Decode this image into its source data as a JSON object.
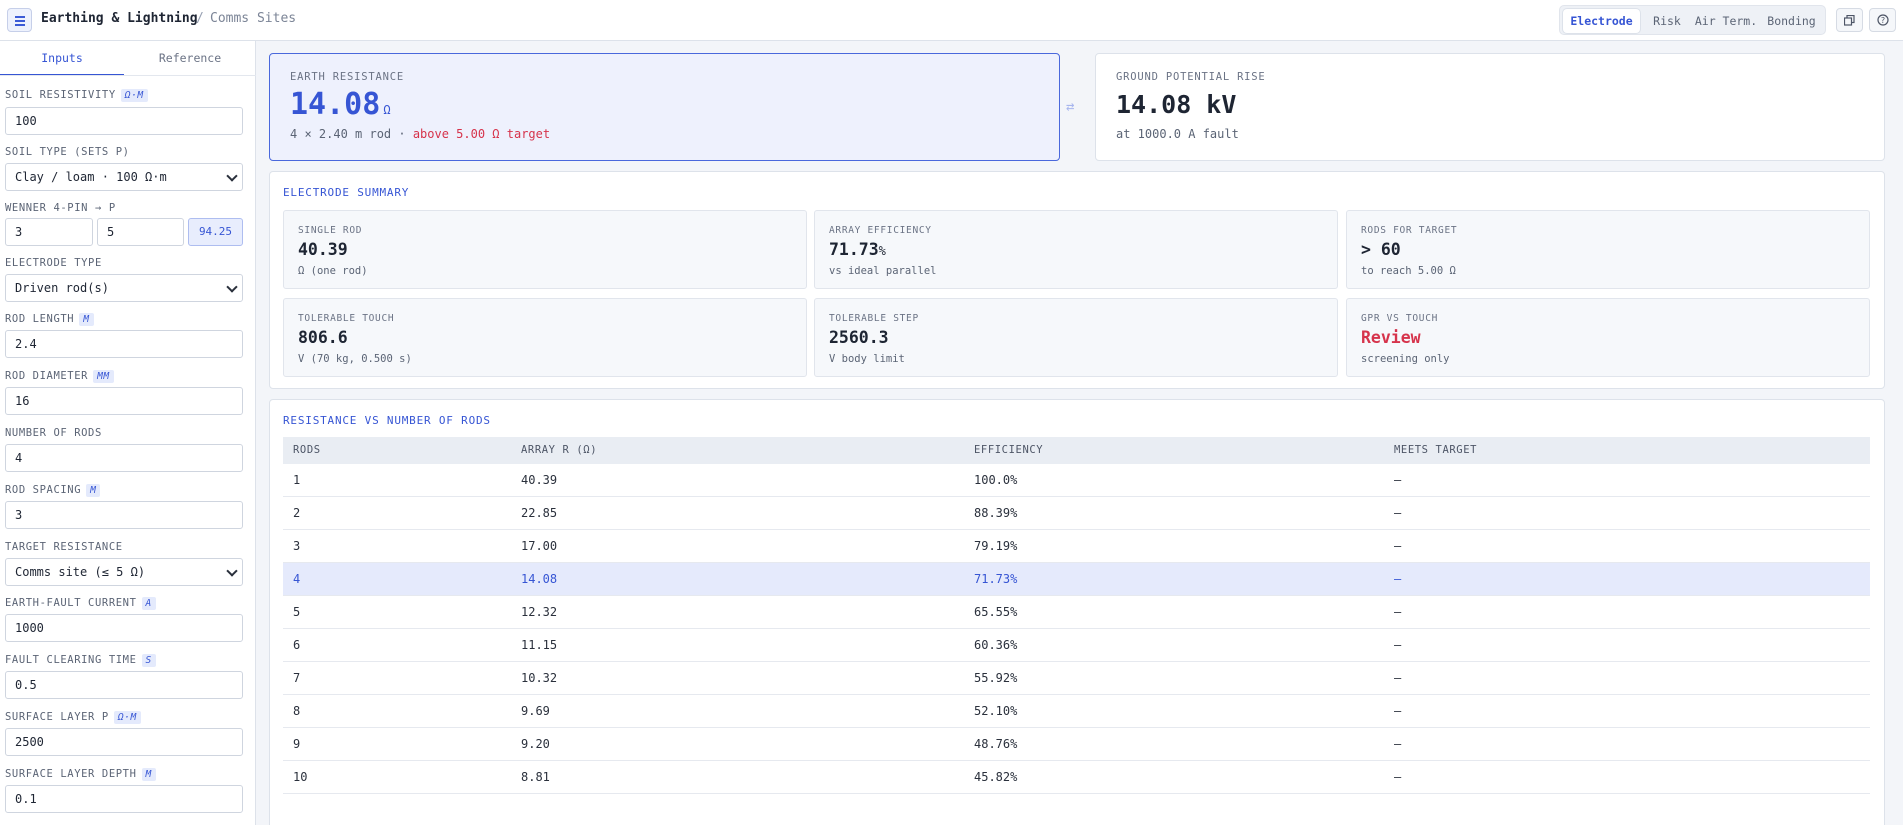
{
  "header": {
    "app_title": "Earthing & Lightning",
    "separator": "/",
    "subtitle": "Comms Sites",
    "tabs": [
      "Electrode",
      "Risk",
      "Air Term.",
      "Bonding"
    ],
    "active_tab": "Electrode"
  },
  "sidebar": {
    "tabs": [
      "Inputs",
      "Reference"
    ],
    "active_tab": "Inputs",
    "fields": {
      "soil_resistivity": {
        "label": "Soil resistivity",
        "unit": "Ω·m",
        "value": "100"
      },
      "soil_type": {
        "label": "Soil type (sets ρ)",
        "value": "Clay / loam · 100 Ω·m"
      },
      "wenner": {
        "label": "Wenner 4-pin → ρ",
        "value_a": "3",
        "value_b": "5",
        "result": "94.25"
      },
      "electrode_type": {
        "label": "Electrode type",
        "value": "Driven rod(s)"
      },
      "rod_length": {
        "label": "Rod length",
        "unit": "m",
        "value": "2.4"
      },
      "rod_diameter": {
        "label": "Rod diameter",
        "unit": "mm",
        "value": "16"
      },
      "number_of_rods": {
        "label": "Number of rods",
        "value": "4"
      },
      "rod_spacing": {
        "label": "Rod spacing",
        "unit": "m",
        "value": "3"
      },
      "target_resistance": {
        "label": "Target resistance",
        "value": "Comms site (≤ 5 Ω)"
      },
      "earth_fault_current": {
        "label": "Earth-fault current",
        "unit": "A",
        "value": "1000"
      },
      "fault_clearing_time": {
        "label": "Fault clearing time",
        "unit": "s",
        "value": "0.5"
      },
      "surface_layer_rho": {
        "label": "Surface layer ρ",
        "unit": "Ω·m",
        "value": "2500"
      },
      "surface_layer_depth": {
        "label": "Surface layer depth",
        "unit": "m",
        "value": "0.1"
      }
    }
  },
  "kpi": {
    "earth_resistance": {
      "label": "Earth resistance",
      "value": "14.08",
      "unit": "Ω",
      "sub_prefix": "4 × 2.40 m rod · ",
      "sub_warning": "above 5.00 Ω target"
    },
    "swap_icon": "⇄",
    "gpr": {
      "label": "Ground potential rise",
      "value": "14.08 kV",
      "sub": "at 1000.0 A fault"
    }
  },
  "summary": {
    "title": "Electrode summary",
    "stats": [
      {
        "label": "Single rod",
        "value": "40.39",
        "suffix": "",
        "sub": "Ω (one rod)"
      },
      {
        "label": "Array efficiency",
        "value": "71.73",
        "suffix": "%",
        "sub": "vs ideal parallel"
      },
      {
        "label": "Rods for target",
        "value": "> 60",
        "suffix": "",
        "sub": "to reach 5.00 Ω"
      },
      {
        "label": "Tolerable touch",
        "value": "806.6",
        "suffix": "",
        "sub": "V (70 kg, 0.500 s)"
      },
      {
        "label": "Tolerable step",
        "value": "2560.3",
        "suffix": "",
        "sub": "V body limit"
      },
      {
        "label": "GPR vs touch",
        "value": "Review",
        "suffix": "",
        "sub": "screening only"
      }
    ]
  },
  "table": {
    "title": "Resistance vs number of rods",
    "headers": [
      "Rods",
      "Array R (Ω)",
      "Efficiency",
      "Meets target"
    ],
    "rows": [
      [
        "1",
        "40.39",
        "100.0%",
        "—"
      ],
      [
        "2",
        "22.85",
        "88.39%",
        "—"
      ],
      [
        "3",
        "17.00",
        "79.19%",
        "—"
      ],
      [
        "4",
        "14.08",
        "71.73%",
        "—"
      ],
      [
        "5",
        "12.32",
        "65.55%",
        "—"
      ],
      [
        "6",
        "11.15",
        "60.36%",
        "—"
      ],
      [
        "7",
        "10.32",
        "55.92%",
        "—"
      ],
      [
        "8",
        "9.69",
        "52.10%",
        "—"
      ],
      [
        "9",
        "9.20",
        "48.76%",
        "—"
      ],
      [
        "10",
        "8.81",
        "45.82%",
        "—"
      ]
    ],
    "highlighted_row": 3
  },
  "colors": {
    "accent": "#3655d4",
    "warning": "#d6334b",
    "highlight_row": "#e5eafc"
  }
}
